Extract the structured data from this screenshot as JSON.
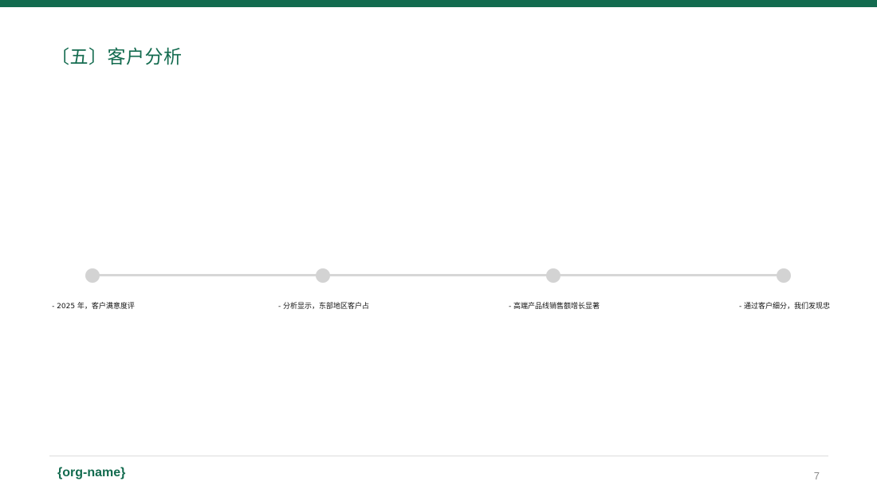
{
  "slide": {
    "title": "〔五〕客户分析"
  },
  "timeline": {
    "points": [
      {
        "text": "- 2025 年，客户满意度评"
      },
      {
        "text": "- 分析显示，东部地区客户占"
      },
      {
        "text": "- 高端产品线销售额增长显著"
      },
      {
        "text": "- 通过客户细分，我们发现忠"
      }
    ]
  },
  "footer": {
    "org_name": "{org-name}",
    "page_number": "7"
  },
  "colors": {
    "accent": "#136b4f",
    "timeline_gray": "#d3d3d3"
  }
}
